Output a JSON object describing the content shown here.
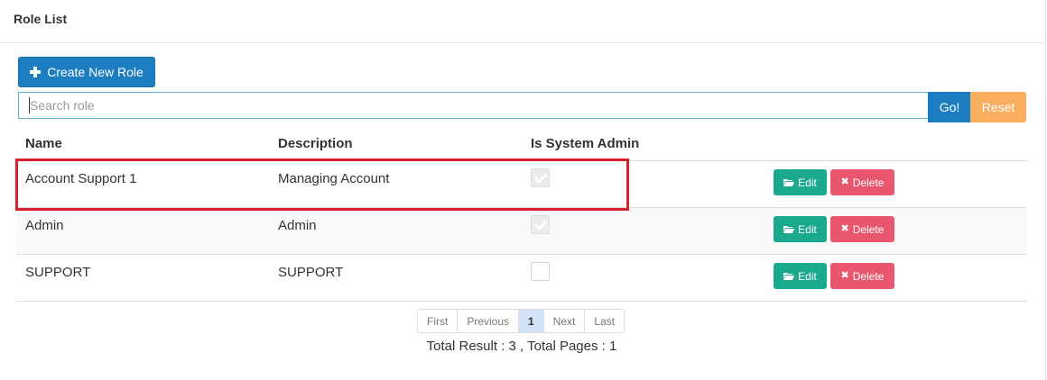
{
  "panel": {
    "title": "Role List"
  },
  "toolbar": {
    "create_label": "Create New Role",
    "search_placeholder": "Search role",
    "search_value": "",
    "go_label": "Go!",
    "reset_label": "Reset"
  },
  "table": {
    "headers": [
      "Name",
      "Description",
      "Is System Admin"
    ],
    "rows": [
      {
        "name": "Account Support 1",
        "description": "Managing Account",
        "is_system_admin": true
      },
      {
        "name": "Admin",
        "description": "Admin",
        "is_system_admin": true
      },
      {
        "name": "SUPPORT",
        "description": "SUPPORT",
        "is_system_admin": false
      }
    ],
    "edit_label": "Edit",
    "delete_label": "Delete"
  },
  "pagination": {
    "first": "First",
    "previous": "Previous",
    "current": "1",
    "next": "Next",
    "last": "Last"
  },
  "summary": "Total Result : 3 , Total Pages : 1",
  "colors": {
    "primary": "#1c7dc1",
    "warning": "#f8ad5f",
    "success": "#1aa98c",
    "danger": "#e9576f",
    "highlight": "#d9202f"
  },
  "icons": {
    "create": "plus-icon",
    "edit": "folder-open-icon",
    "delete": "x-icon"
  }
}
